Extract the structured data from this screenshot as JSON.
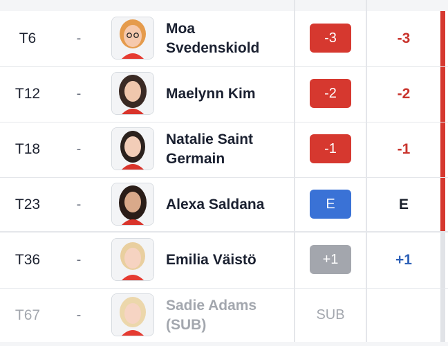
{
  "colors": {
    "under_par": "#d6382f",
    "even": "#3a72d6",
    "over_par": "#a3a6ad",
    "total_under": "#c9342d",
    "total_over": "#2f62b8",
    "total_even": "#1a1f2b"
  },
  "players": [
    {
      "pos": "T6",
      "move": "-",
      "name": "Moa Svedenskiold",
      "today": "-3",
      "total": "-3"
    },
    {
      "pos": "T12",
      "move": "-",
      "name": "Maelynn Kim",
      "today": "-2",
      "total": "-2"
    },
    {
      "pos": "T18",
      "move": "-",
      "name": "Natalie Saint Germain",
      "today": "-1",
      "total": "-1"
    },
    {
      "pos": "T23",
      "move": "-",
      "name": "Alexa Saldana",
      "today": "E",
      "total": "E"
    },
    {
      "pos": "T36",
      "move": "-",
      "name": "Emilia Väistö",
      "today": "+1",
      "total": "+1"
    },
    {
      "pos": "T67",
      "move": "-",
      "name": "Sadie Adams (SUB)",
      "today": "SUB",
      "total": ""
    }
  ]
}
